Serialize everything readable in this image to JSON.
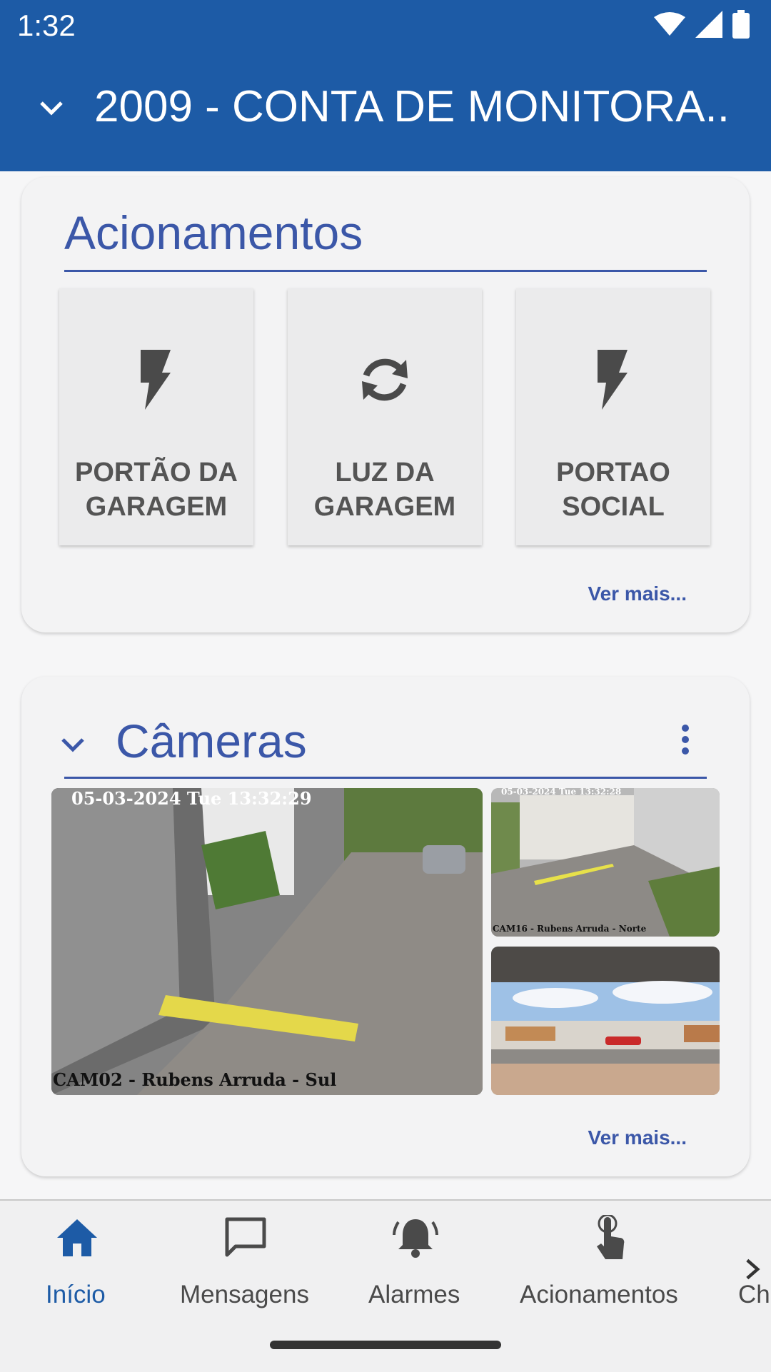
{
  "status_bar": {
    "time": "1:32"
  },
  "app_bar": {
    "title": "2009 - CONTA DE MONITORA.."
  },
  "acionamentos_card": {
    "title": "Acionamentos",
    "tiles": [
      {
        "label": "PORTÃO DA\nGARAGEM",
        "icon": "lightning-icon"
      },
      {
        "label": "LUZ DA\nGARAGEM",
        "icon": "refresh-icon"
      },
      {
        "label": "PORTAO\nSOCIAL",
        "icon": "lightning-icon"
      }
    ],
    "more_link": "Ver mais..."
  },
  "cameras_card": {
    "title": "Câmeras",
    "cameras": [
      {
        "timestamp": "05-03-2024 Tue 13:32:29",
        "label": "CAM02 - Rubens Arruda - Sul"
      },
      {
        "timestamp": "05-03-2024 Tue 13:32:28",
        "label": "CAM16 - Rubens Arruda - Norte"
      },
      {
        "timestamp": "",
        "label": ""
      }
    ],
    "more_link": "Ver mais..."
  },
  "bottom_nav": {
    "items": [
      {
        "label": "Início",
        "icon": "home-icon",
        "active": true
      },
      {
        "label": "Mensagens",
        "icon": "message-icon",
        "active": false
      },
      {
        "label": "Alarmes",
        "icon": "bell-icon",
        "active": false
      },
      {
        "label": "Acionamentos",
        "icon": "touch-icon",
        "active": false
      },
      {
        "label": "Cha",
        "icon": "chevron-right-icon",
        "active": false
      }
    ]
  },
  "colors": {
    "primary": "#1d5ba6",
    "accent": "#3b57a8"
  }
}
